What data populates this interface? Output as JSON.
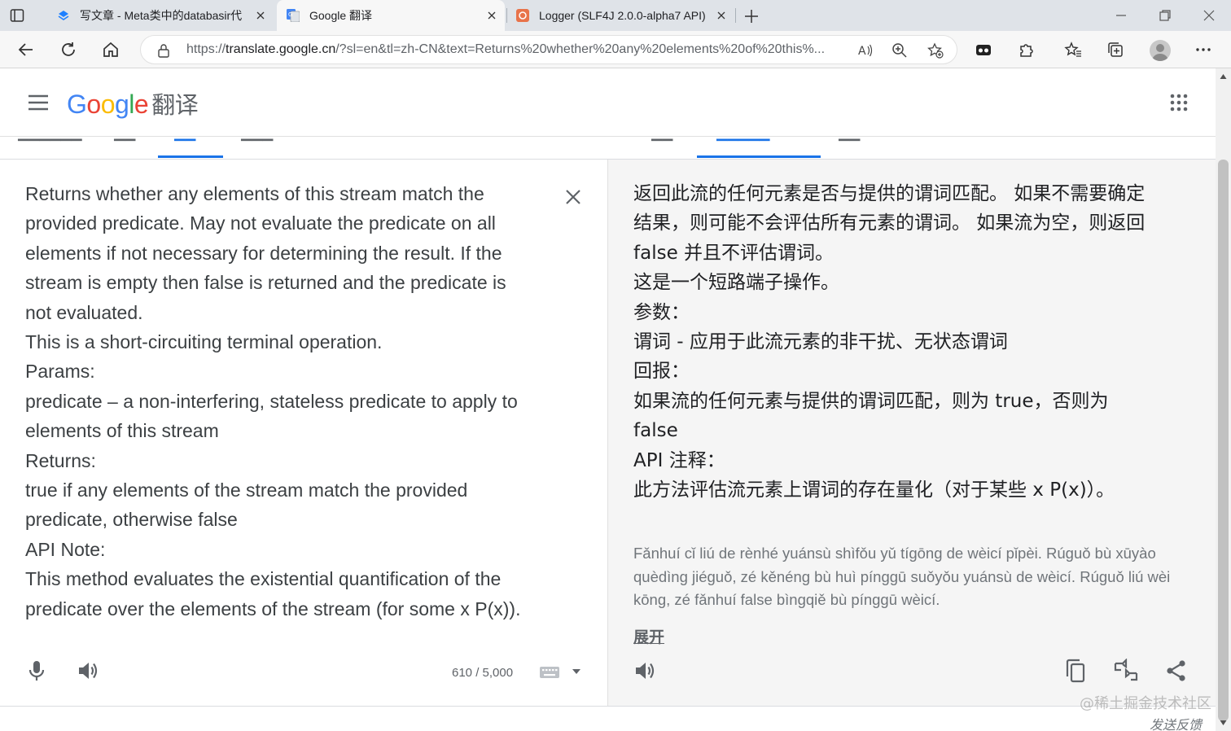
{
  "browser": {
    "tabs": [
      {
        "title": "写文章 - Meta类中的databasir代",
        "active": false
      },
      {
        "title": "Google 翻译",
        "active": true
      },
      {
        "title": "Logger (SLF4J 2.0.0-alpha7 API)",
        "active": false
      }
    ],
    "url_prefix": "https://",
    "url_host": "translate.google.cn",
    "url_rest": "/?sl=en&tl=zh-CN&text=Returns%20whether%20any%20elements%20of%20this%...",
    "colors": {
      "tabstrip": "#dfe3e8",
      "active_tab": "#f7f7f7"
    }
  },
  "header": {
    "logo_letters": [
      "G",
      "o",
      "o",
      "g",
      "l",
      "e"
    ],
    "product": "翻译"
  },
  "source": {
    "lines": [
      "Returns whether any elements of this stream match the",
      "provided predicate. May not evaluate the predicate on all",
      "elements if not necessary for determining the result. If the",
      "stream is empty then false is returned and the predicate is",
      "not evaluated.",
      "This is a short-circuiting terminal operation.",
      "Params:",
      "predicate – a non-interfering, stateless predicate to apply to",
      "elements of this stream",
      "Returns:",
      "true if any elements of the stream match the provided",
      "predicate, otherwise false",
      "API Note:",
      "This method evaluates the existential quantification of the",
      "predicate over the elements of the stream (for some x P(x))."
    ],
    "char_count": "610 / 5,000"
  },
  "target": {
    "lines": [
      "返回此流的任何元素是否与提供的谓词匹配。 如果不需要确定",
      "结果，则可能不会评估所有元素的谓词。 如果流为空，则返回",
      "false 并且不评估谓词。",
      "这是一个短路端子操作。",
      "参数：",
      "谓词 - 应用于此流元素的非干扰、无状态谓词",
      "回报：",
      "如果流的任何元素与提供的谓词匹配，则为 true，否则为",
      "false",
      "API 注释：",
      "此方法评估流元素上谓词的存在量化（对于某些 x P(x)）。"
    ],
    "romanization": [
      "Fǎnhuí cǐ liú de rènhé yuánsù shìfǒu yǔ tígōng de wèicí pǐpèi. Rúguǒ bù xūyào",
      "quèdìng jiéguǒ, zé kěnéng bù huì pínggū suǒyǒu yuánsù de wèicí. Rúguǒ liú wèi",
      "kōng, zé fǎnhuí false bìngqiě bù pínggū wèicí."
    ],
    "expand_label": "展开"
  },
  "footer": {
    "watermark": "@稀土掘金技术社区",
    "feedback": "发送反馈"
  }
}
